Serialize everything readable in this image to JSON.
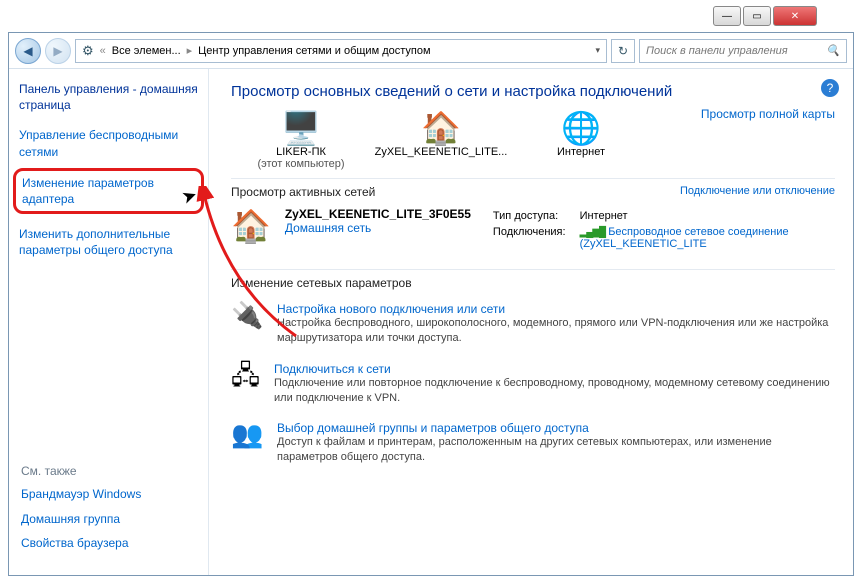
{
  "titlebar": {
    "min": "—",
    "max": "▭",
    "close": "✕"
  },
  "nav": {
    "back": "◀",
    "forward": "▶"
  },
  "breadcrumb": {
    "prefix_icon": "«",
    "crumb1": "Все элемен...",
    "crumb2": "Центр управления сетями и общим доступом"
  },
  "search": {
    "placeholder": "Поиск в панели управления",
    "icon": "🔍"
  },
  "refresh_icon": "↻",
  "help_icon": "?",
  "sidebar": {
    "home": "Панель управления - домашняя страница",
    "items": [
      "Управление беспроводными сетями",
      "Изменение параметров адаптера",
      "Изменить дополнительные параметры общего доступа"
    ],
    "seealso_hdr": "См. также",
    "seealso": [
      "Брандмауэр Windows",
      "Домашняя группа",
      "Свойства браузера"
    ]
  },
  "main": {
    "heading": "Просмотр основных сведений о сети и настройка подключений",
    "fullmap": "Просмотр полной карты",
    "node_pc": {
      "name": "LIKER-ПК",
      "sub": "(этот компьютер)",
      "icon": "🖥️"
    },
    "node_net": {
      "name": "ZyXEL_KEENETIC_LITE...",
      "icon": "🏠"
    },
    "node_inet": {
      "name": "Интернет",
      "icon": "🌐"
    },
    "active_hdr": "Просмотр активных сетей",
    "active_link": "Подключение или отключение",
    "active": {
      "icon": "🏠",
      "name": "ZyXEL_KEENETIC_LITE_3F0E55",
      "type": "Домашняя сеть",
      "access_lbl": "Тип доступа:",
      "access_val": "Интернет",
      "conn_lbl": "Подключения:",
      "conn_val": "Беспроводное сетевое соединение (ZyXEL_KEENETIC_LITE",
      "sig": "▂▄▆█"
    },
    "change_hdr": "Изменение сетевых параметров",
    "opts": [
      {
        "icon": "🔌",
        "title": "Настройка нового подключения или сети",
        "desc": "Настройка беспроводного, широкополосного, модемного, прямого или VPN-подключения или же настройка маршрутизатора или точки доступа."
      },
      {
        "icon": "🖧",
        "title": "Подключиться к сети",
        "desc": "Подключение или повторное подключение к беспроводному, проводному, модемному сетевому соединению или подключение к VPN."
      },
      {
        "icon": "👥",
        "title": "Выбор домашней группы и параметров общего доступа",
        "desc": "Доступ к файлам и принтерам, расположенным на других сетевых компьютерах, или изменение параметров общего доступа."
      }
    ]
  }
}
